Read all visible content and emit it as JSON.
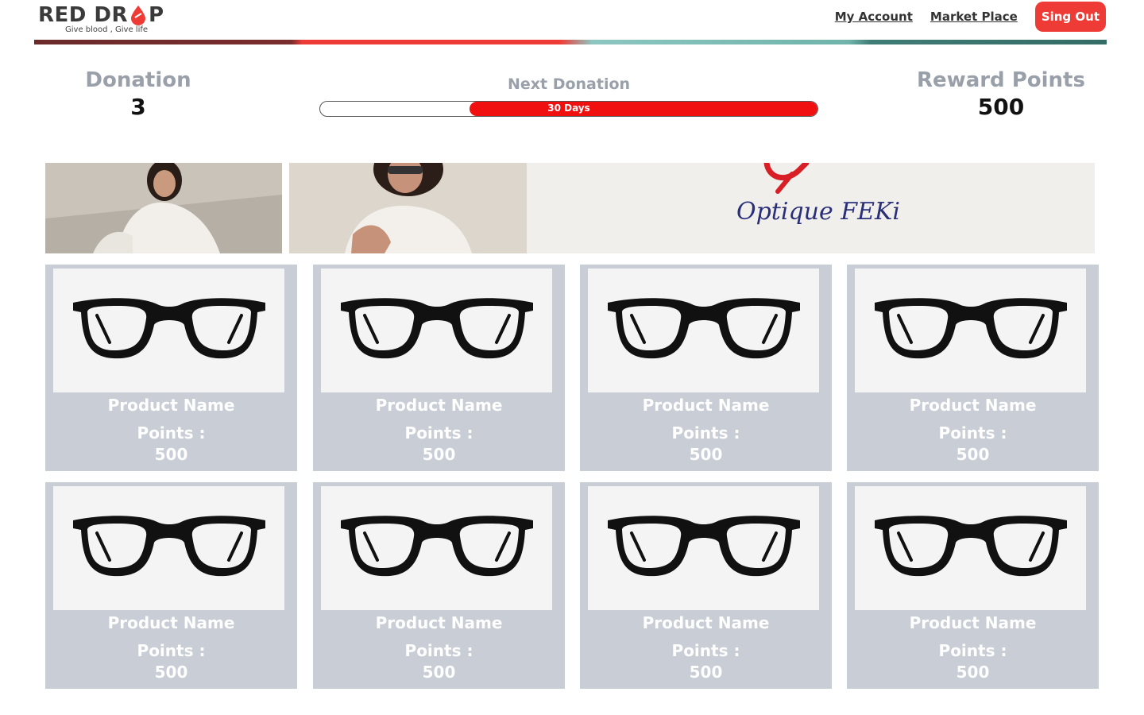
{
  "brand": {
    "logo_left": "RED DR",
    "logo_right": "P",
    "tagline": "Give blood , Give life"
  },
  "nav": {
    "my_account": "My Account",
    "market_place": "Market Place",
    "sign_out": "Sing Out"
  },
  "stats": {
    "donation_label": "Donation",
    "donation_value": "3",
    "next_donation_label": "Next Donation",
    "next_donation_days": "30 Days",
    "next_donation_progress": 0.7,
    "reward_label": "Reward Points",
    "reward_value": "500"
  },
  "banner": {
    "brand_text": "Optique FEKi"
  },
  "products": [
    {
      "name": "Product Name",
      "points_label": "Points :",
      "points": "500",
      "icon": "eyeglasses-icon"
    },
    {
      "name": "Product Name",
      "points_label": "Points :",
      "points": "500",
      "icon": "eyeglasses-icon"
    },
    {
      "name": "Product Name",
      "points_label": "Points :",
      "points": "500",
      "icon": "eyeglasses-icon"
    },
    {
      "name": "Product Name",
      "points_label": "Points :",
      "points": "500",
      "icon": "eyeglasses-icon"
    },
    {
      "name": "Product Name",
      "points_label": "Points :",
      "points": "500",
      "icon": "eyeglasses-icon"
    },
    {
      "name": "Product Name",
      "points_label": "Points :",
      "points": "500",
      "icon": "eyeglasses-icon"
    },
    {
      "name": "Product Name",
      "points_label": "Points :",
      "points": "500",
      "icon": "eyeglasses-icon"
    },
    {
      "name": "Product Name",
      "points_label": "Points :",
      "points": "500",
      "icon": "eyeglasses-icon"
    }
  ],
  "colors": {
    "brand_red": "#ef3b36",
    "progress_red": "#f01010",
    "card_bg": "#c8cdd6",
    "label_gray": "#9aa0aa"
  }
}
